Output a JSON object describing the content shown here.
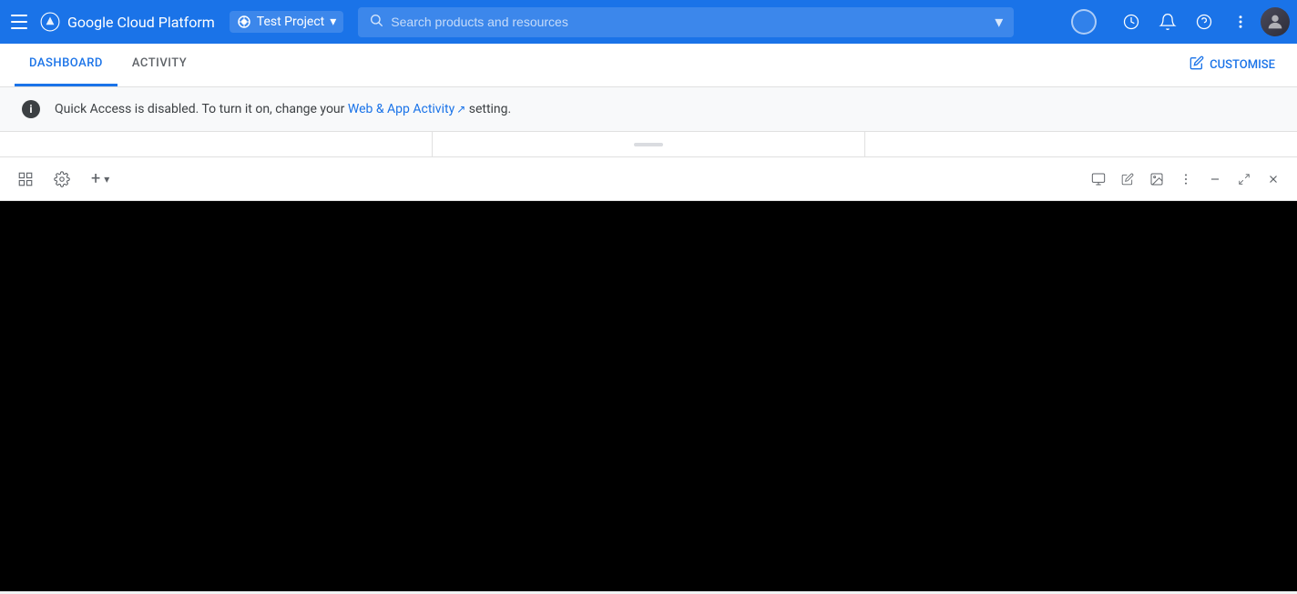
{
  "topbar": {
    "title": "Google Cloud Platform",
    "project": {
      "name": "Test Project",
      "dropdown_label": "▾"
    },
    "search": {
      "placeholder": "Search products and resources"
    },
    "icons": {
      "menu": "☰",
      "search": "🔍",
      "expand": "▾",
      "support_history": "⏱",
      "help": "?",
      "notifications": "🔔",
      "more": "⋮"
    }
  },
  "tabs": {
    "items": [
      {
        "id": "dashboard",
        "label": "DASHBOARD",
        "active": true
      },
      {
        "id": "activity",
        "label": "ACTIVITY",
        "active": false
      }
    ],
    "customise_label": "CUSTOMISE"
  },
  "info_banner": {
    "message_prefix": "Quick Access is disabled. To turn it on, change your ",
    "link_text": "Web & App Activity",
    "message_suffix": " setting."
  },
  "widget_toolbar": {
    "restore_icon": "⊞",
    "settings_icon": "⚙",
    "add_label": "+",
    "add_dropdown": "▾",
    "right_icons": {
      "monitor": "🖥",
      "edit": "✏",
      "image": "🖼",
      "more": "⋮",
      "minimize": "—",
      "expand": "⤢",
      "close": "✕"
    }
  }
}
